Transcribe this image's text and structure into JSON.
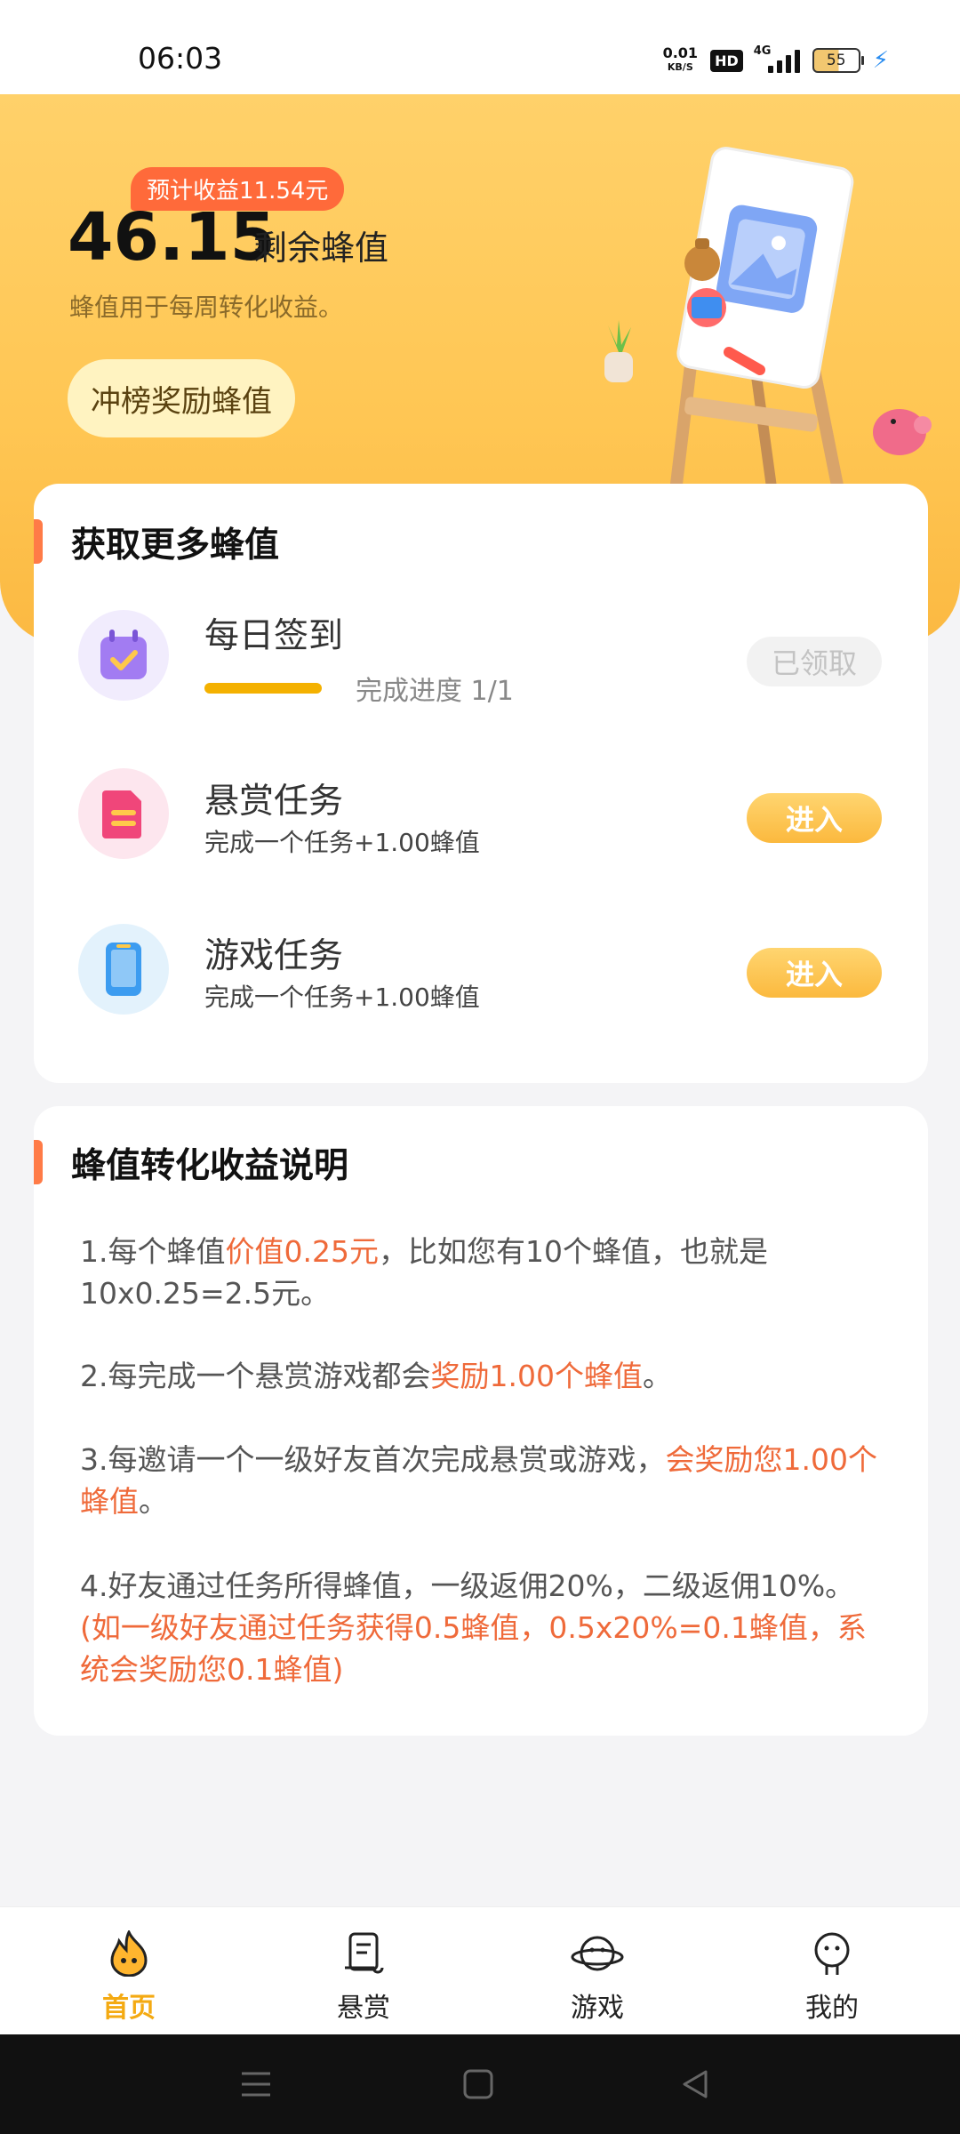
{
  "status": {
    "time": "06:03",
    "net_speed_top": "0.01",
    "net_speed_bottom": "KB/S",
    "hd": "HD",
    "network": "4G",
    "battery": "55"
  },
  "hero": {
    "estimate_badge": "预计收益11.54元",
    "balance": "46.15",
    "balance_label": "剩余蜂值",
    "description": "蜂值用于每周转化收益。",
    "rank_button": "冲榜奖励蜂值"
  },
  "earn_card": {
    "title": "获取更多蜂值",
    "tasks": [
      {
        "title": "每日签到",
        "progress_text": "完成进度 1/1",
        "progress": 1.0,
        "button": "已领取"
      },
      {
        "title": "悬赏任务",
        "subtitle": "完成一个任务+1.00蜂值",
        "button": "进入"
      },
      {
        "title": "游戏任务",
        "subtitle": "完成一个任务+1.00蜂值",
        "button": "进入"
      }
    ]
  },
  "rules_card": {
    "title": "蜂值转化收益说明",
    "items": [
      {
        "pre": "1.每个蜂值",
        "hl": "价值0.25元",
        "post": "，比如您有10个蜂值，也就是10x0.25=2.5元。"
      },
      {
        "pre": "2.每完成一个悬赏游戏都会",
        "hl": "奖励1.00个蜂值",
        "post": "。"
      },
      {
        "pre": "3.每邀请一个一级好友首次完成悬赏或游戏，",
        "hl": "会奖励您1.00个蜂值",
        "post": "。"
      },
      {
        "pre": "4.好友通过任务所得蜂值，一级返佣20%，二级返佣10%。",
        "hl": "(如一级好友通过任务获得0.5蜂值，0.5x20%=0.1蜂值，系统会奖励您0.1蜂值)",
        "post": ""
      }
    ]
  },
  "tabbar": {
    "tabs": [
      "首页",
      "悬赏",
      "游戏",
      "我的"
    ],
    "active": 0
  },
  "colors": {
    "accent": "#f4aa12",
    "highlight": "#ef6a3a",
    "hero": "#ffc653"
  }
}
